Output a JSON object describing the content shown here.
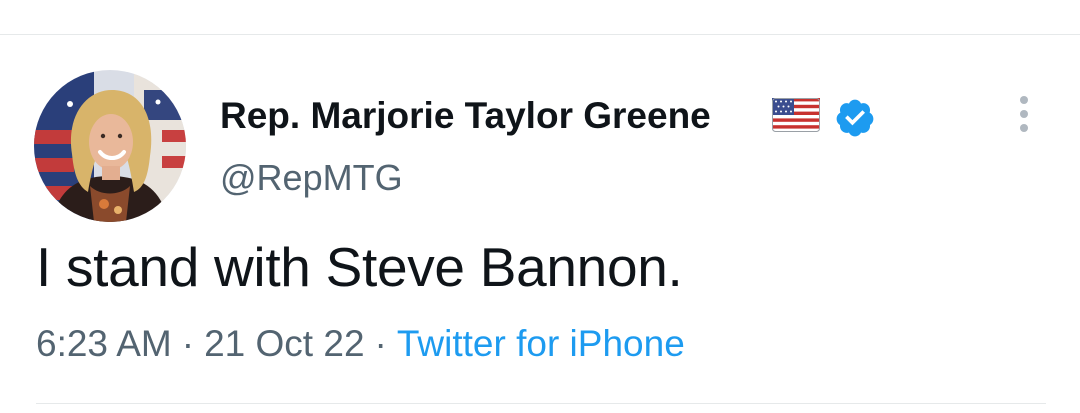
{
  "tweet": {
    "author": {
      "display_name": "Rep. Marjorie Taylor Greene",
      "handle": "@RepMTG",
      "name_emoji": "us-flag-icon",
      "verified": true,
      "verified_color": "#1d9bf0"
    },
    "text": "I stand with Steve Bannon.",
    "meta": {
      "time": "6:23 AM",
      "separator": "·",
      "date": "21 Oct 22",
      "source": "Twitter for iPhone"
    }
  },
  "colors": {
    "text": "#0f1419",
    "secondary": "#536471",
    "link": "#1d9bf0",
    "divider": "#e6e9ea"
  }
}
